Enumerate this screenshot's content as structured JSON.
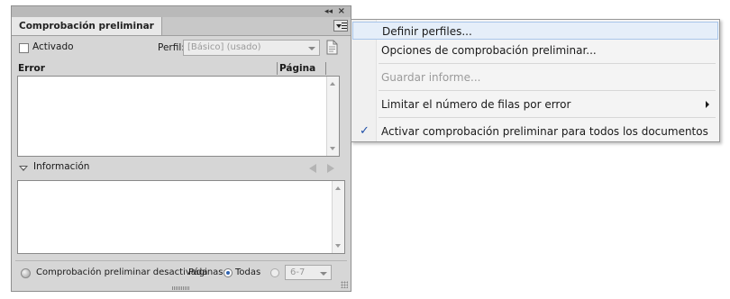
{
  "panel": {
    "tab_title": "Comprobación preliminar",
    "activado_label": "Activado",
    "perfil_label": "Perfil:",
    "perfil_value": "[Básico] (usado)",
    "columns": [
      "Error",
      "Página"
    ],
    "info_label": "Información",
    "status_text": "Comprobación preliminar desactivada",
    "paginas_label": "Páginas:",
    "todas_label": "Todas",
    "range_value": "6-7"
  },
  "menu": {
    "items": [
      {
        "label": "Definir perfiles...",
        "enabled": true
      },
      {
        "label": "Opciones de comprobación preliminar...",
        "enabled": true
      },
      {
        "label": "Guardar informe...",
        "enabled": false
      },
      {
        "label": "Limitar el número de filas por error",
        "enabled": true,
        "submenu": true
      },
      {
        "label": "Activar comprobación preliminar para todos los documentos",
        "enabled": true,
        "checked": true
      }
    ],
    "check_glyph": "✓"
  },
  "colors": {
    "panel_bg": "#d6d6d6",
    "menu_highlight": "#e5eef9",
    "check": "#1f4fa8"
  }
}
